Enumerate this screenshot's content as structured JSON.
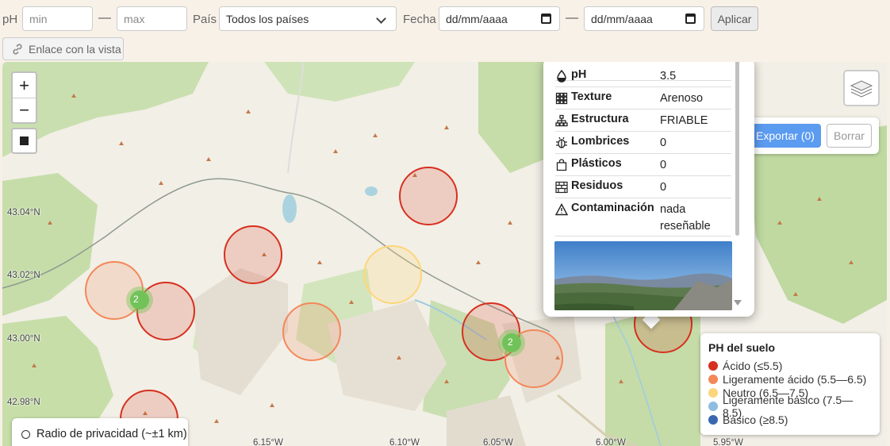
{
  "filters": {
    "ph_label": "pH",
    "ph_min_placeholder": "min",
    "ph_max_placeholder": "max",
    "dash": "—",
    "country_label": "País",
    "country_value": "Todos los países",
    "date_label": "Fecha",
    "date_from_placeholder": "dd/mm/aaaa",
    "date_to_placeholder": "dd/mm/aaaa",
    "apply_label": "Aplicar",
    "share_link_label": "Enlace con la vista"
  },
  "map_controls": {
    "zoom_in": "+",
    "zoom_out": "−"
  },
  "map": {
    "lat_labels": [
      "43.04°N",
      "43.02°N",
      "43.00°N",
      "42.98°N"
    ],
    "lon_labels": [
      "6.15°W",
      "6.10°W",
      "6.05°W",
      "6.00°W",
      "5.95°W"
    ],
    "cluster_counts": [
      "2",
      "2"
    ]
  },
  "export": {
    "export_label": "Exportar (0)",
    "clear_label": "Borrar"
  },
  "popup": {
    "rows": [
      {
        "key": "pH",
        "value": "3.5",
        "icon": "drop-icon"
      },
      {
        "key": "Texture",
        "value": "Arenoso",
        "icon": "grid-icon"
      },
      {
        "key": "Estructura",
        "value": "FRIABLE",
        "icon": "structure-icon"
      },
      {
        "key": "Lombrices",
        "value": "0",
        "icon": "bug-icon"
      },
      {
        "key": "Plásticos",
        "value": "0",
        "icon": "bag-icon"
      },
      {
        "key": "Residuos",
        "value": "0",
        "icon": "bricks-icon"
      },
      {
        "key": "Contaminación",
        "value": "nada reseñable",
        "icon": "warning-icon"
      }
    ]
  },
  "legend": {
    "title": "PH del suelo",
    "items": [
      {
        "label": "Ácido (≤5.5)",
        "color": "#d7301f"
      },
      {
        "label": "Ligeramente ácido (5.5—6.5)",
        "color": "#f4875a"
      },
      {
        "label": "Neutro (6.5—7.5)",
        "color": "#fdd67a"
      },
      {
        "label": "Ligeramente básico (7.5—8.5)",
        "color": "#8fbde0"
      },
      {
        "label": "Básico (≥8.5)",
        "color": "#3a67b0"
      }
    ]
  },
  "privacy": {
    "label": "Radio de privacidad (~±1 km)"
  }
}
